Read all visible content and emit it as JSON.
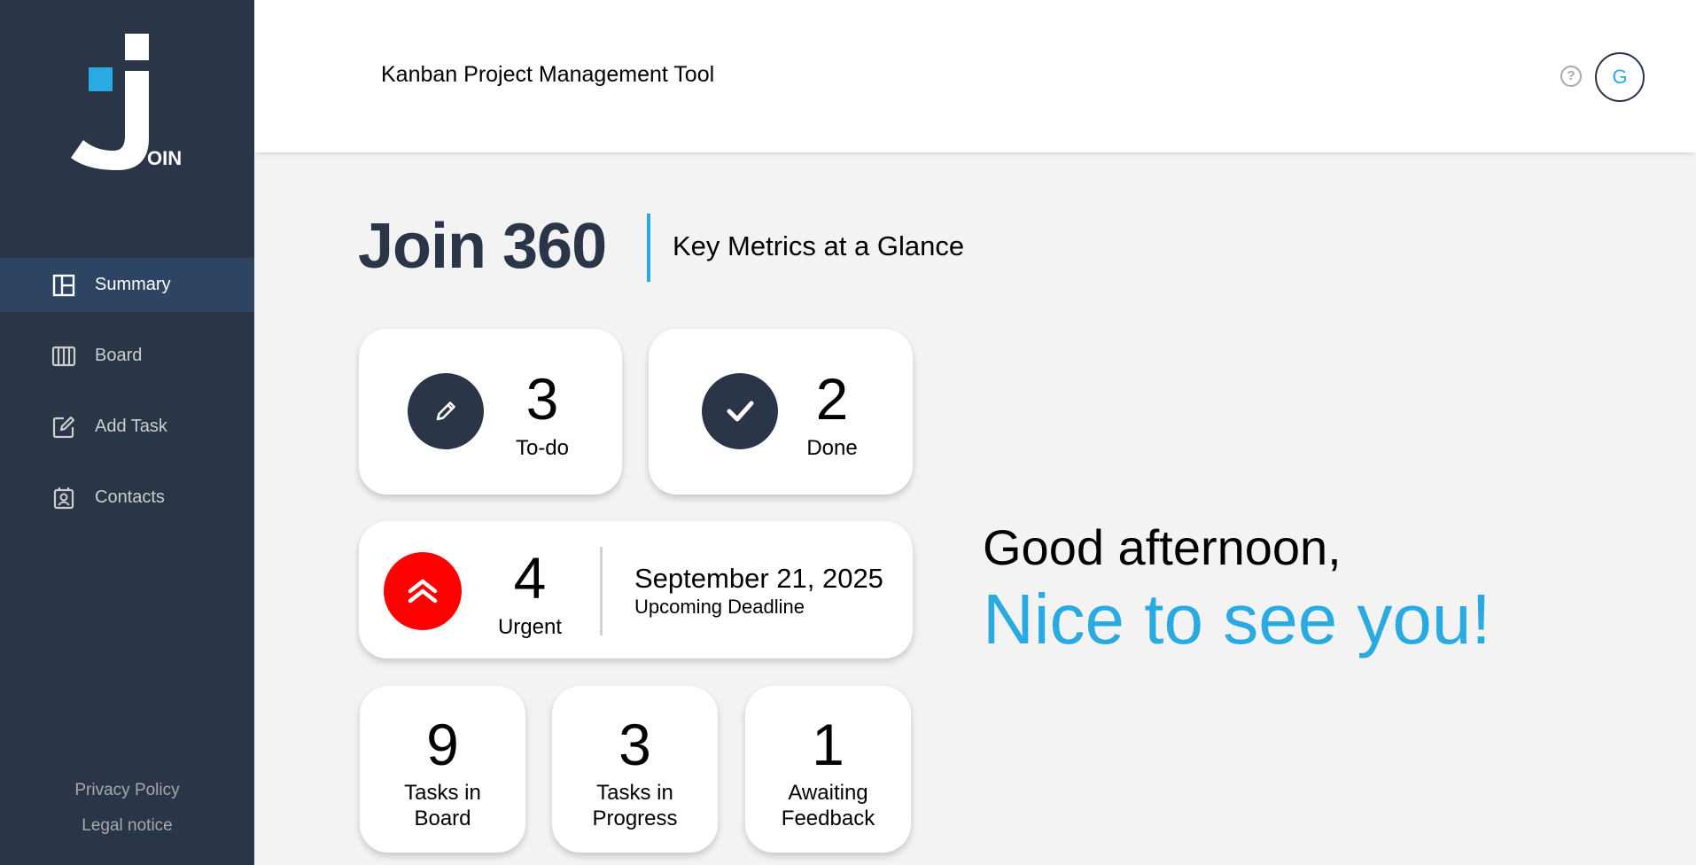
{
  "app": {
    "title": "Kanban Project Management Tool",
    "logo_text": "OIN"
  },
  "colors": {
    "sidebar": "#2a3647",
    "accent": "#29abe2",
    "urgent": "#ff0000"
  },
  "header": {
    "help_icon": "?",
    "avatar_initial": "G"
  },
  "sidebar": {
    "items": [
      {
        "label": "Summary",
        "icon": "summary-icon",
        "active": true
      },
      {
        "label": "Board",
        "icon": "board-icon",
        "active": false
      },
      {
        "label": "Add Task",
        "icon": "add-task-icon",
        "active": false
      },
      {
        "label": "Contacts",
        "icon": "contacts-icon",
        "active": false
      }
    ],
    "privacy_policy": "Privacy Policy",
    "legal_notice": "Legal notice"
  },
  "page": {
    "title": "Join 360",
    "subtitle": "Key Metrics at a Glance"
  },
  "metrics": {
    "todo": {
      "count": "3",
      "label": "To-do"
    },
    "done": {
      "count": "2",
      "label": "Done"
    },
    "urgent": {
      "count": "4",
      "label": "Urgent"
    },
    "deadline": {
      "date": "September 21, 2025",
      "label": "Upcoming Deadline"
    },
    "board": {
      "count": "9",
      "label_line1": "Tasks in",
      "label_line2": "Board"
    },
    "progress": {
      "count": "3",
      "label_line1": "Tasks in",
      "label_line2": "Progress"
    },
    "feedback": {
      "count": "1",
      "label_line1": "Awaiting",
      "label_line2": "Feedback"
    }
  },
  "greeting": {
    "text": "Good afternoon,",
    "name": "Nice to see you!"
  }
}
